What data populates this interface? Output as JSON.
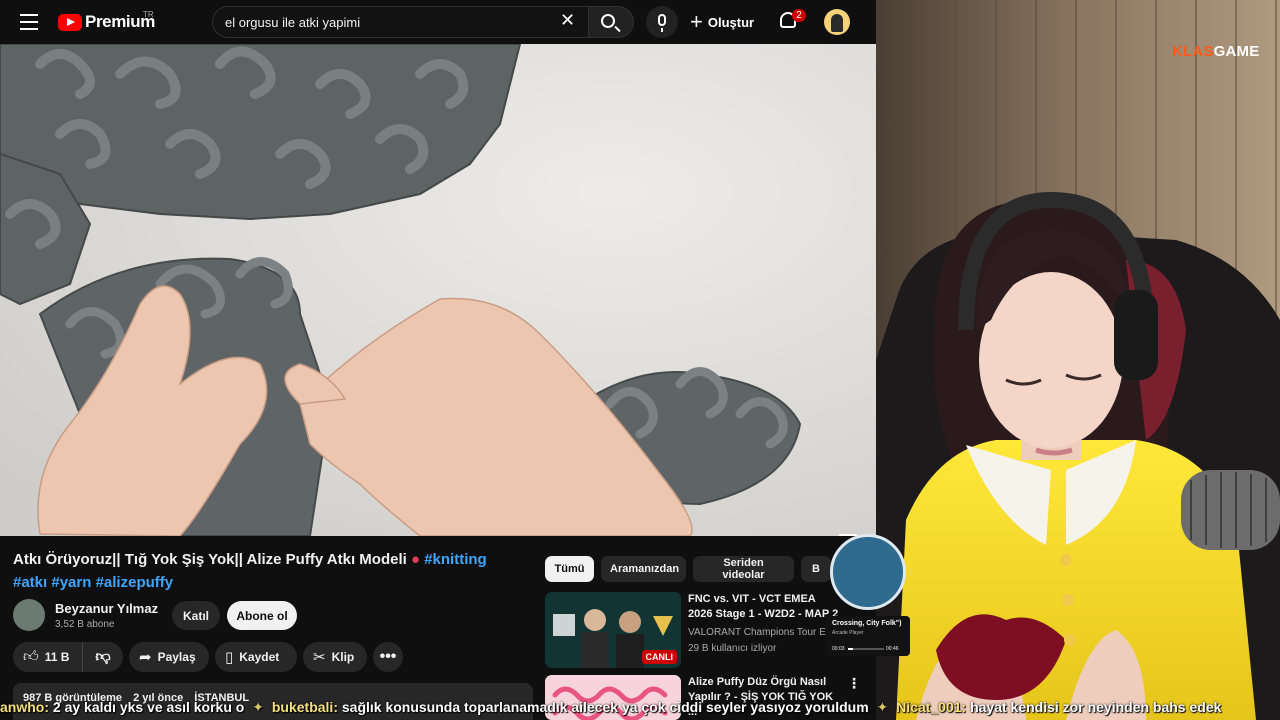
{
  "topbar": {
    "logo_text": "Premium",
    "logo_region": "TR",
    "search_value": "el orgusu ile atki yapimi",
    "create_label": "Oluştur",
    "notification_count": "2"
  },
  "video": {
    "title": "Atkı Örüyoruz|| Tığ Yok Şiş Yok|| Alize Puffy Atkı Modeli",
    "hashtags": [
      "#knitting",
      "#atkı",
      "#yarn",
      "#alizepuffy"
    ],
    "channel_name": "Beyzanur Yılmaz",
    "channel_subs": "3,52 B abone",
    "join_label": "Katıl",
    "subscribe_label": "Abone ol",
    "like_count": "11 B",
    "share_label": "Paylaş",
    "save_label": "Kaydet",
    "clip_label": "Klip",
    "views": "987 B görüntüleme",
    "age": "2 yıl önce",
    "location": "İSTANBUL"
  },
  "chips": [
    "Tümü",
    "Aramanızdan",
    "Seriden videolar",
    "B"
  ],
  "recommendations": [
    {
      "title": "FNC vs. VIT - VCT EMEA 2026 Stage 1 - W2D2 - MAP 2",
      "channel": "VALORANT Champions Tour EMEA",
      "views": "29 B kullanıcı izliyor",
      "badge": "CANLI"
    },
    {
      "title": "Alize Puffy Düz Örgü Nasıl Yapılır ? - ŞİŞ YOK TIĞ YOK ...",
      "channel": "",
      "views": ""
    }
  ],
  "stream": {
    "brand_orange": "KLAS",
    "brand_white": "GAME",
    "music_title": "Crossing, City Folk\")",
    "music_sub": "Arcade Player",
    "music_elapsed": "00:03",
    "music_total": "00:46",
    "music_progress": 0.15
  },
  "chat": [
    {
      "user": "anwho:",
      "text": "2 ay kaldı yks ve asıl korku o"
    },
    {
      "user": "buketbali:",
      "text": "sağlık konusunda toparlanamadık ailecek ya çok ciddi seyler yasıyoz yoruldum"
    },
    {
      "user": "Nicat_001:",
      "text": "hayat kendisi zor neyinden bahs edek"
    }
  ],
  "colors": {
    "accent_red": "#ff0000",
    "link_blue": "#3ea6ff",
    "brand_orange": "#ff5a1e",
    "chat_user": "#f5e07a"
  }
}
